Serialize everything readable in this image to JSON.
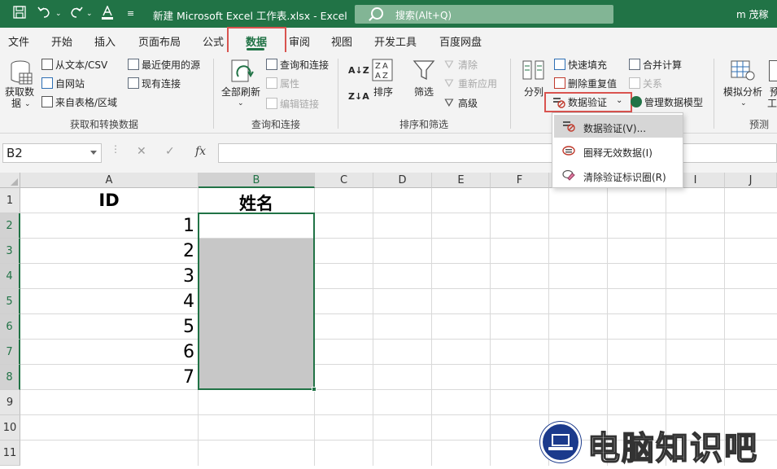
{
  "title_bar": {
    "title": "新建 Microsoft Excel 工作表.xlsx  -  Excel",
    "search_placeholder": "搜索(Alt+Q)",
    "user": "m 茂稼"
  },
  "tabs": [
    "文件",
    "开始",
    "插入",
    "页面布局",
    "公式",
    "数据",
    "审阅",
    "视图",
    "开发工具",
    "百度网盘"
  ],
  "active_tab": "数据",
  "ribbon": {
    "get_data": "获取数",
    "get_data_2": "据",
    "from_text_csv": "从文本/CSV",
    "from_web": "自网站",
    "from_table": "来自表格/区域",
    "recent_sources": "最近使用的源",
    "existing_connections": "现有连接",
    "group_get_transform": "获取和转换数据",
    "refresh_all": "全部刷新",
    "queries_connections": "查询和连接",
    "properties": "属性",
    "edit_links": "编辑链接",
    "group_queries": "查询和连接",
    "sort_az": "A↓Z",
    "sort_za": "Z↓A",
    "sort": "排序",
    "filter": "筛选",
    "clear": "清除",
    "reapply": "重新应用",
    "advanced": "高级",
    "group_sort_filter": "排序和筛选",
    "text_to_columns": "分列",
    "flash_fill": "快速填充",
    "remove_duplicates": "删除重复值",
    "data_validation": "数据验证",
    "consolidate": "合并计算",
    "relationships": "关系",
    "manage_data_model": "管理数据模型",
    "what_if": "模拟分析",
    "forecast_sheet_partial": "预",
    "forecast_sheet_partial2": "工",
    "group_forecast": "预测"
  },
  "formula_bar": {
    "name_box": "B2",
    "cancel": "✕",
    "enter": "✓",
    "fx": "fx",
    "formula": ""
  },
  "columns": [
    "A",
    "B",
    "C",
    "D",
    "E",
    "F",
    "G",
    "H",
    "I",
    "J"
  ],
  "rows": [
    "1",
    "2",
    "3",
    "4",
    "5",
    "6",
    "7",
    "8",
    "9",
    "10",
    "11"
  ],
  "cells": {
    "A1": "ID",
    "B1": "姓名",
    "A_values": [
      "1",
      "2",
      "3",
      "4",
      "5",
      "6",
      "7"
    ]
  },
  "selection": "B2:B8",
  "dropdown_menu": {
    "items": [
      "数据验证(V)...",
      "圈释无效数据(I)",
      "清除验证标识圈(R)"
    ],
    "highlighted_index": 0
  },
  "watermark": "电脑知识吧",
  "colors": {
    "excel_green": "#217346",
    "highlight_red": "#d9534f",
    "selected_fill": "#c7c7c7"
  }
}
